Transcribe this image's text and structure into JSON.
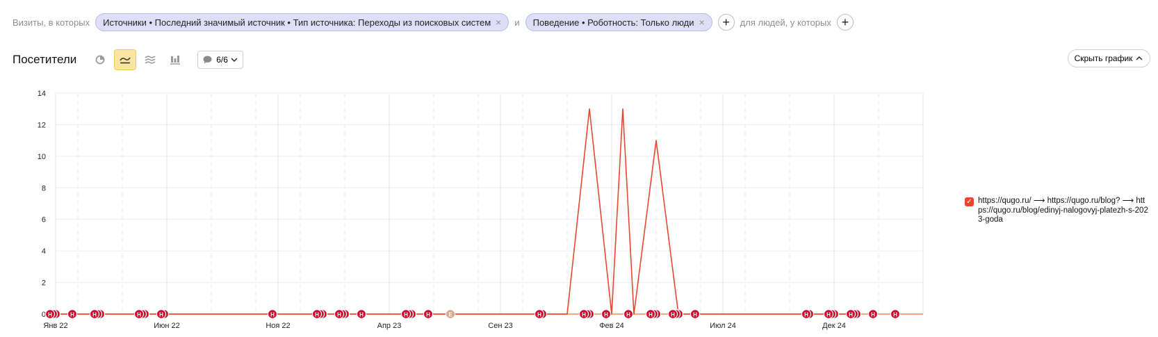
{
  "filters": {
    "prefix": "Визиты, в которых",
    "chips": [
      {
        "label": "Источники • Последний значимый источник • Тип источника: Переходы из поисковых систем"
      },
      {
        "label": "Поведение • Роботность: Только люди"
      }
    ],
    "conjunction": "и",
    "people_label": "для людей, у которых",
    "add_symbol": "+",
    "remove_symbol": "×"
  },
  "toolbar": {
    "title": "Посетители",
    "chart_modes": [
      {
        "icon": "pie-chart-icon",
        "active": false
      },
      {
        "icon": "line-chart-icon",
        "active": true
      },
      {
        "icon": "stacked-area-icon",
        "active": false
      },
      {
        "icon": "column-chart-icon",
        "active": false
      }
    ],
    "notes_count": "6/6",
    "notes_icon": "comment-icon",
    "chevron_icon": "chevron-down-icon"
  },
  "hide_chart": {
    "label": "Скрыть график",
    "icon": "chevron-up-icon"
  },
  "legend": {
    "items": [
      {
        "checked": true,
        "label": "https://qugo.ru/ ⟶ https://qugo.ru/blog? ⟶ https://qugo.ru/blog/edinyj-nalogovyj-platezh-s-2023-goda",
        "color": "#e8472c"
      }
    ]
  },
  "chart_data": {
    "type": "line",
    "title": "",
    "xlabel": "",
    "ylabel": "",
    "ylim": [
      0,
      14
    ],
    "yticks": [
      0,
      2,
      4,
      6,
      8,
      10,
      12,
      14
    ],
    "xlim": [
      "2022-01",
      "2025-01"
    ],
    "x_tick_labels": [
      "Янв 22",
      "Июн 22",
      "Ноя 22",
      "Апр 23",
      "Сен 23",
      "Фев 24",
      "Июл 24",
      "Дек 24"
    ],
    "x_tick_months": [
      "2022-01",
      "2022-06",
      "2022-11",
      "2023-04",
      "2023-09",
      "2024-02",
      "2024-07",
      "2024-12"
    ],
    "grid": true,
    "legend_position": "right",
    "series": [
      {
        "color": "#e8472c",
        "x": [
          "2022-01",
          "2023-12",
          "2024-01",
          "2024-02",
          "2024-02",
          "2024-03",
          "2024-04",
          "2024-05",
          "2025-01"
        ],
        "values": [
          0,
          0,
          13,
          0,
          13,
          0,
          11,
          0,
          0
        ]
      }
    ],
    "annotations": [
      {
        "month": "2022-01",
        "count": 3,
        "letter": "Н"
      },
      {
        "month": "2022-02",
        "count": 1,
        "letter": "Н"
      },
      {
        "month": "2022-03",
        "count": 3,
        "letter": "Н"
      },
      {
        "month": "2022-05",
        "count": 3,
        "letter": "Н"
      },
      {
        "month": "2022-06",
        "count": 2,
        "letter": "Н"
      },
      {
        "month": "2022-11",
        "count": 1,
        "letter": "Н"
      },
      {
        "month": "2023-01",
        "count": 3,
        "letter": "Н"
      },
      {
        "month": "2023-02",
        "count": 3,
        "letter": "Н"
      },
      {
        "month": "2023-03",
        "count": 1,
        "letter": "Н"
      },
      {
        "month": "2023-05",
        "count": 3,
        "letter": "Н"
      },
      {
        "month": "2023-06",
        "count": 1,
        "letter": "Н"
      },
      {
        "month": "2023-07",
        "count": 1,
        "letter": "Е",
        "muted": true
      },
      {
        "month": "2023-11",
        "count": 2,
        "letter": "Н"
      },
      {
        "month": "2024-01",
        "count": 3,
        "letter": "Н"
      },
      {
        "month": "2024-02",
        "count": 1,
        "letter": "Н"
      },
      {
        "month": "2024-03",
        "count": 1,
        "letter": "Н"
      },
      {
        "month": "2024-04",
        "count": 3,
        "letter": "Н"
      },
      {
        "month": "2024-05",
        "count": 3,
        "letter": "Н"
      },
      {
        "month": "2024-06",
        "count": 1,
        "letter": "Н"
      },
      {
        "month": "2024-11",
        "count": 2,
        "letter": "Н"
      },
      {
        "month": "2024-12",
        "count": 3,
        "letter": "Н"
      },
      {
        "month": "2025-01",
        "count": 3,
        "letter": "Н"
      },
      {
        "month": "2025-02",
        "count": 1,
        "letter": "Н"
      },
      {
        "month": "2025-03",
        "count": 1,
        "letter": "Н"
      }
    ]
  }
}
